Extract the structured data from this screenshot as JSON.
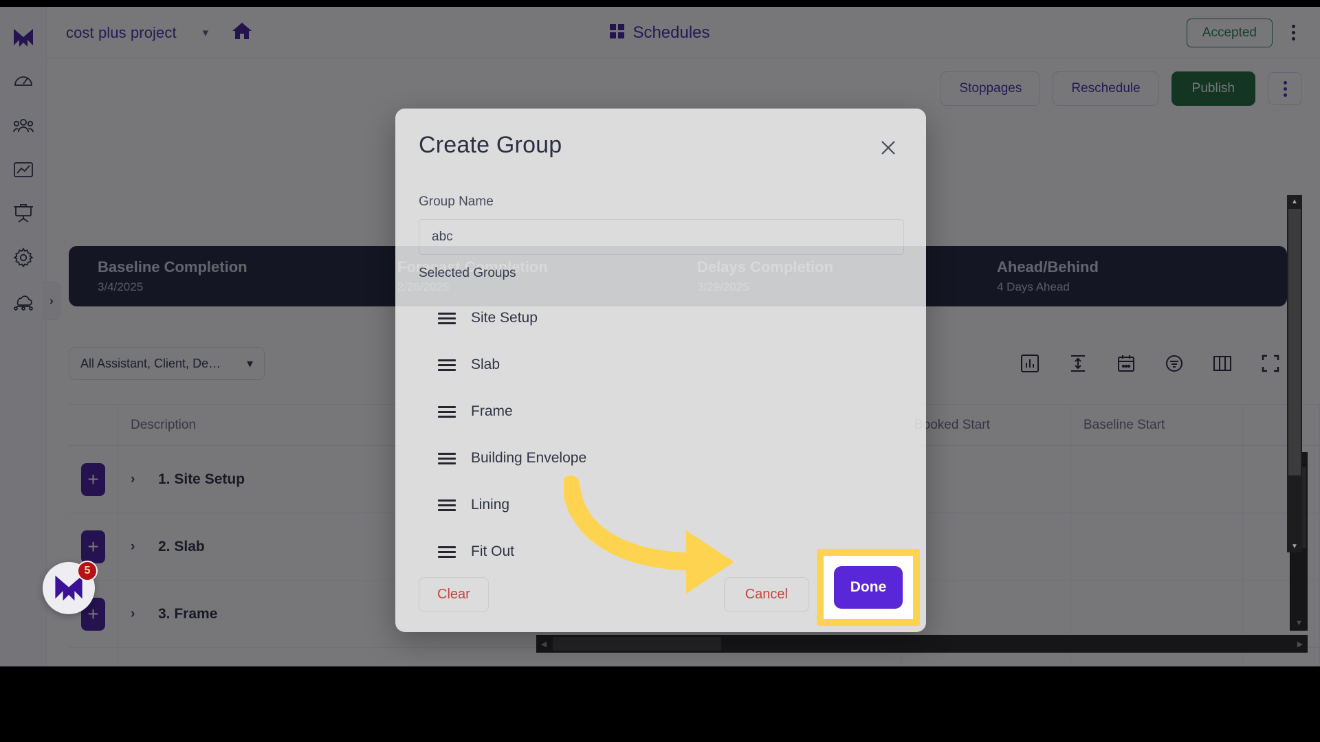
{
  "app": {
    "header": {
      "project_name": "cost plus project",
      "project_caret": "chevron-down",
      "center_title": "Schedules",
      "status_badge": "Accepted"
    },
    "actionbar": {
      "stoppages": "Stoppages",
      "reschedule": "Reschedule",
      "publish": "Publish"
    },
    "stats": [
      {
        "label": "Baseline Completion",
        "value": "3/4/2025"
      },
      {
        "label": "Forecast Completion",
        "value": "2/26/2025"
      },
      {
        "label": "Delays Completion",
        "value": "3/29/2025"
      },
      {
        "label": "Ahead/Behind",
        "value": "4 Days Ahead"
      }
    ],
    "filter": {
      "dropdown_value": "All Assistant, Client, De…",
      "tools": [
        "bar-chart-icon",
        "row-height-icon",
        "calendar-icon",
        "filter-icon",
        "columns-icon",
        "fullscreen-icon"
      ]
    },
    "table": {
      "columns": [
        "",
        "Description",
        "Booked Start",
        "Baseline Start",
        ""
      ],
      "rows": [
        {
          "add": "+",
          "caret": "›",
          "label": "1. Site Setup",
          "booked_start": "",
          "baseline_start": ""
        },
        {
          "add": "+",
          "caret": "›",
          "label": "2. Slab",
          "booked_start": "",
          "baseline_start": ""
        },
        {
          "add": "+",
          "caret": "›",
          "label": "3. Frame",
          "booked_start": "",
          "baseline_start": ""
        }
      ]
    },
    "sidebar": {
      "items": [
        {
          "name": "logo-icon",
          "label": "Logo"
        },
        {
          "name": "dashboard-icon",
          "label": "Dashboard"
        },
        {
          "name": "team-icon",
          "label": "Team"
        },
        {
          "name": "analytics-icon",
          "label": "Analytics"
        },
        {
          "name": "presentation-icon",
          "label": "Board"
        },
        {
          "name": "settings-icon",
          "label": "Settings"
        },
        {
          "name": "cloud-network-icon",
          "label": "Integrations"
        }
      ],
      "collapse_caret": "›"
    },
    "chat_fab": {
      "badge": "5"
    }
  },
  "modal": {
    "title": "Create Group",
    "close_icon": "close-icon",
    "group_name_label": "Group Name",
    "group_name_value": "abc",
    "group_name_placeholder": "Group Name",
    "selected_groups_label": "Selected Groups",
    "groups": [
      {
        "name": "Site Setup"
      },
      {
        "name": "Slab"
      },
      {
        "name": "Frame"
      },
      {
        "name": "Building Envelope"
      },
      {
        "name": "Lining"
      },
      {
        "name": "Fit Out"
      }
    ],
    "clear_label": "Clear",
    "cancel_label": "Cancel",
    "done_label": "Done"
  },
  "annotation": {
    "highlight_target": "Done",
    "arrow_color": "#fdd34f",
    "highlight_color": "#fdd34f"
  },
  "colors": {
    "brand_purple": "#3b1fa3",
    "button_purple": "#5a27d8",
    "publish_green": "#11622f",
    "accepted_green": "#1d7a40",
    "danger_red": "#d33b32",
    "stat_navy": "#151a30",
    "highlight_yellow": "#fdd34f"
  }
}
